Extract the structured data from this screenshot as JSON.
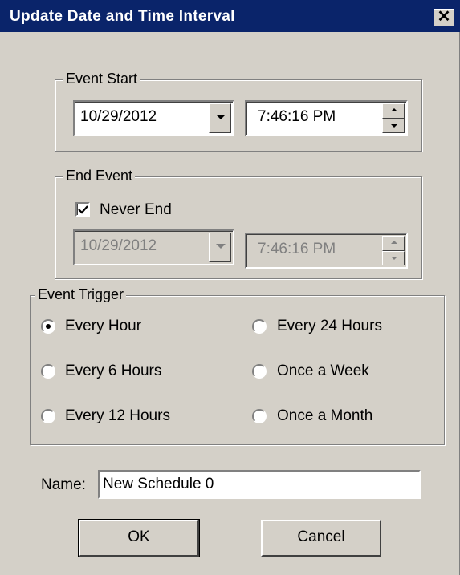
{
  "window": {
    "title": "Update Date and Time Interval",
    "close_glyph": "✕"
  },
  "event_start": {
    "legend": "Event Start",
    "date": "10/29/2012",
    "time": "7:46:16 PM"
  },
  "end_event": {
    "legend": "End Event",
    "never_end_label": "Never End",
    "never_end_checked": true,
    "date": "10/29/2012",
    "time": "7:46:16 PM"
  },
  "event_trigger": {
    "legend": "Event Trigger",
    "options": [
      {
        "label": "Every Hour",
        "selected": true
      },
      {
        "label": "Every 24 Hours",
        "selected": false
      },
      {
        "label": "Every 6 Hours",
        "selected": false
      },
      {
        "label": "Once a Week",
        "selected": false
      },
      {
        "label": "Every 12 Hours",
        "selected": false
      },
      {
        "label": "Once a Month",
        "selected": false
      }
    ]
  },
  "name_field": {
    "label": "Name:",
    "value": "New Schedule 0"
  },
  "buttons": {
    "ok": "OK",
    "cancel": "Cancel"
  },
  "colors": {
    "title_bar": "#0a246a",
    "face": "#d4d0c8",
    "disabled_text": "#808080"
  }
}
